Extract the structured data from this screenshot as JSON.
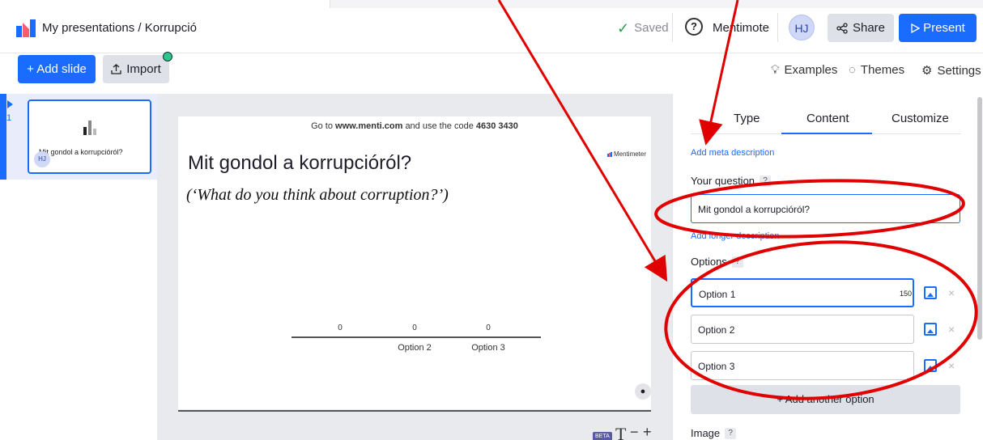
{
  "header": {
    "breadcrumb": "My presentations / Korrupció",
    "saved_label": "Saved",
    "mentimote_label": "Mentimote",
    "avatar_initials": "HJ",
    "share_label": "Share",
    "present_label": "Present"
  },
  "toolbar": {
    "add_slide_label": "+ Add slide",
    "import_label": "Import",
    "examples_label": "Examples",
    "themes_label": "Themes",
    "settings_label": "Settings"
  },
  "slides": [
    {
      "number": "1",
      "title": "Mit gondol a korrupcióról?",
      "avatar": "HJ"
    }
  ],
  "slide": {
    "go_to_prefix": "Go to",
    "go_to_url": "www.menti.com",
    "go_to_middle": "and use the code",
    "code": "4630 3430",
    "brand": "Mentimeter",
    "question": "Mit gondol a korrupcióról?",
    "translation": "(‘What do you think about corruption?’)",
    "beta_label": "BETA"
  },
  "chart_data": {
    "type": "bar",
    "categories": [
      "",
      "Option 2",
      "Option 3"
    ],
    "values": [
      0,
      0,
      0
    ],
    "title": "",
    "xlabel": "",
    "ylabel": ""
  },
  "panel": {
    "tabs": [
      "Type",
      "Content",
      "Customize"
    ],
    "active_tab": "Content",
    "meta_link": "Add meta description",
    "question_label": "Your question",
    "question_value": "Mit gondol a korrupcióról?",
    "longer_link": "Add longer description",
    "options_label": "Options",
    "options": [
      {
        "value": "Option 1",
        "counter": "150"
      },
      {
        "value": "Option 2",
        "counter": ""
      },
      {
        "value": "Option 3",
        "counter": ""
      }
    ],
    "add_option_label": "+ Add another option",
    "image_label": "Image",
    "help_mark": "?"
  },
  "colors": {
    "accent": "#196cff",
    "annotation": "#e00000"
  }
}
